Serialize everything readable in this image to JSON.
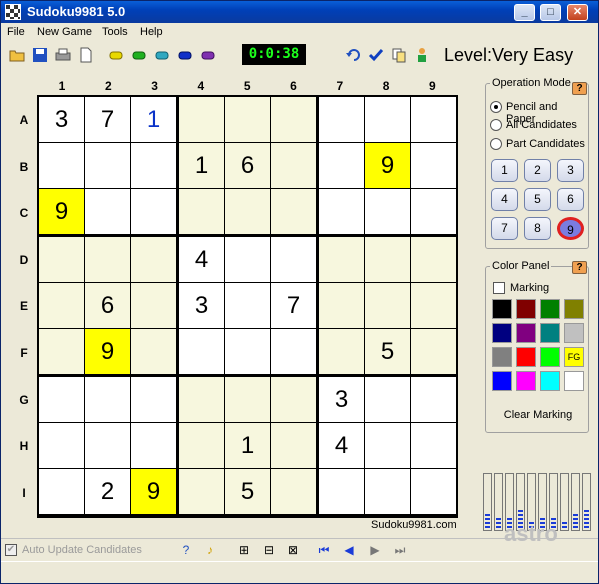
{
  "window": {
    "title": "Sudoku9981 5.0",
    "min": "_",
    "max": "□",
    "close": "✕"
  },
  "menu": {
    "file": "File",
    "new_game": "New Game",
    "tools": "Tools",
    "help": "Help"
  },
  "toolbar": {
    "timer": "0:0:38",
    "level": "Level:Very Easy"
  },
  "board": {
    "col_headers": [
      "1",
      "2",
      "3",
      "4",
      "5",
      "6",
      "7",
      "8",
      "9"
    ],
    "row_headers": [
      "A",
      "B",
      "C",
      "D",
      "E",
      "F",
      "G",
      "H",
      "I"
    ],
    "rows": [
      [
        "3",
        "7",
        "1",
        "",
        "",
        "",
        "",
        "",
        ""
      ],
      [
        "",
        "",
        "",
        "1",
        "6",
        "",
        "",
        "9",
        ""
      ],
      [
        "9",
        "",
        "",
        "",
        "",
        "",
        "",
        "",
        ""
      ],
      [
        "",
        "",
        "",
        "4",
        "",
        "",
        "",
        "",
        ""
      ],
      [
        "",
        "6",
        "",
        "3",
        "",
        "7",
        "",
        "",
        ""
      ],
      [
        "",
        "9",
        "",
        "",
        "",
        "",
        "",
        "5",
        ""
      ],
      [
        "",
        "",
        "",
        "",
        "",
        "",
        "3",
        "",
        ""
      ],
      [
        "",
        "",
        "",
        "",
        "1",
        "",
        "4",
        "",
        ""
      ],
      [
        "",
        "2",
        "9",
        "",
        "5",
        "",
        "",
        "",
        ""
      ]
    ],
    "highlighted": [
      "B8",
      "C1",
      "F2",
      "I3"
    ],
    "user_entered": [
      "A3"
    ],
    "site": "Sudoku9981.com"
  },
  "operation_mode": {
    "title": "Operation Mode",
    "help": "?",
    "options": [
      "Pencil and Paper",
      "All Candidates",
      "Part Candidates"
    ],
    "selected": "Pencil and Paper",
    "numbers": [
      "1",
      "2",
      "3",
      "4",
      "5",
      "6",
      "7",
      "8",
      "9"
    ],
    "selected_number": "9"
  },
  "color_panel": {
    "title": "Color Panel",
    "help": "?",
    "marking_label": "Marking",
    "marking_checked": false,
    "swatches": [
      "#000000",
      "#800000",
      "#008000",
      "#808000",
      "#000080",
      "#800080",
      "#008080",
      "#c0c0c0",
      "#808080",
      "#ff0000",
      "#00ff00",
      "#ffff00",
      "#0000ff",
      "#ff00ff",
      "#00ffff",
      "#ffffff"
    ],
    "fg_label": "FG",
    "clear_label": "Clear Marking"
  },
  "status": {
    "auto_update_label": "Auto Update Candidates",
    "auto_update_checked": true
  },
  "watermark": "astro"
}
